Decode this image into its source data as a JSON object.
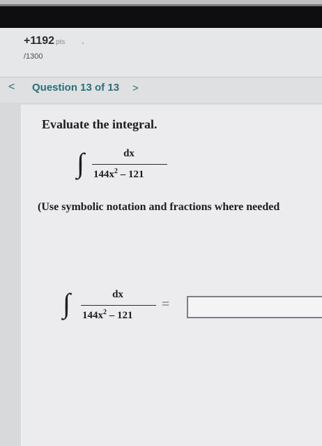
{
  "header": {
    "points_value": "+1192",
    "points_unit": "pts",
    "points_total": "/1300"
  },
  "nav": {
    "question_label": "Question 13 of 13",
    "prev_glyph": "<",
    "next_glyph": ">"
  },
  "question": {
    "prompt": "Evaluate the integral.",
    "integral_sign": "∫",
    "numerator": "dx",
    "denominator_base": "144x",
    "denominator_exp": "2",
    "denominator_rest": " – 121",
    "note": "(Use symbolic notation and fractions where needed"
  },
  "answer": {
    "integral_sign": "∫",
    "numerator": "dx",
    "denominator_base": "144x",
    "denominator_exp": "2",
    "denominator_rest": " – 121",
    "equals": "=",
    "value": ""
  },
  "colors": {
    "accent": "#2a6f78",
    "topbar": "#0e0e10"
  }
}
